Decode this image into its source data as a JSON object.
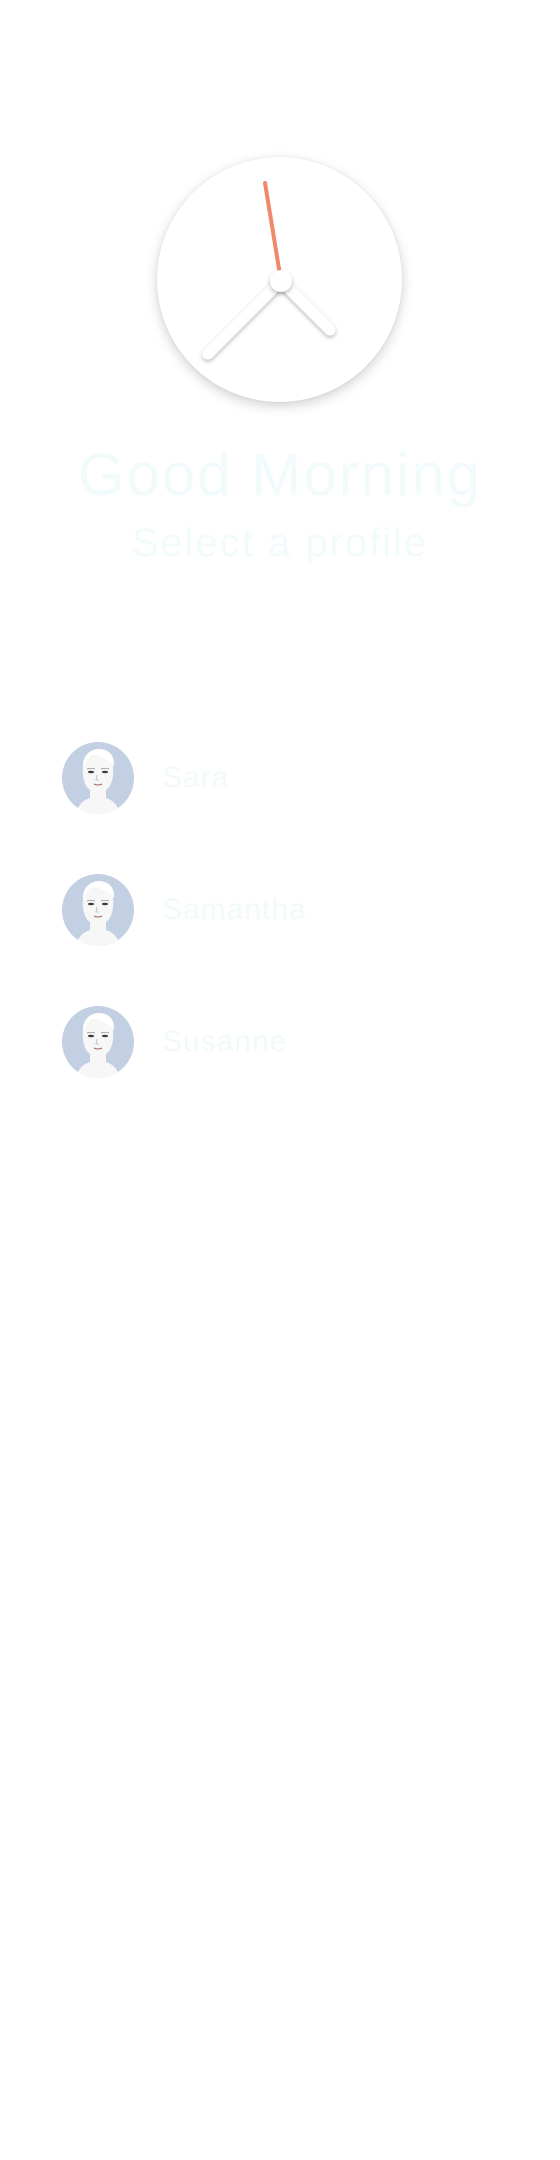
{
  "clock": {
    "hands": {
      "second_color": "#f0886a",
      "hand_color": "#ffffff"
    }
  },
  "header": {
    "greeting": "Good Morning",
    "subtitle": "Select a profile"
  },
  "contacts": [
    {
      "name": "Sara",
      "avatar_icon": "female-face-avatar-icon"
    },
    {
      "name": "Samantha",
      "avatar_icon": "female-face-avatar-icon"
    },
    {
      "name": "Susanne",
      "avatar_icon": "female-face-avatar-icon"
    }
  ],
  "colors": {
    "avatar_bg": "#c3cfe3",
    "text_faint": "#f2fbfc",
    "accent": "#f0886a"
  }
}
